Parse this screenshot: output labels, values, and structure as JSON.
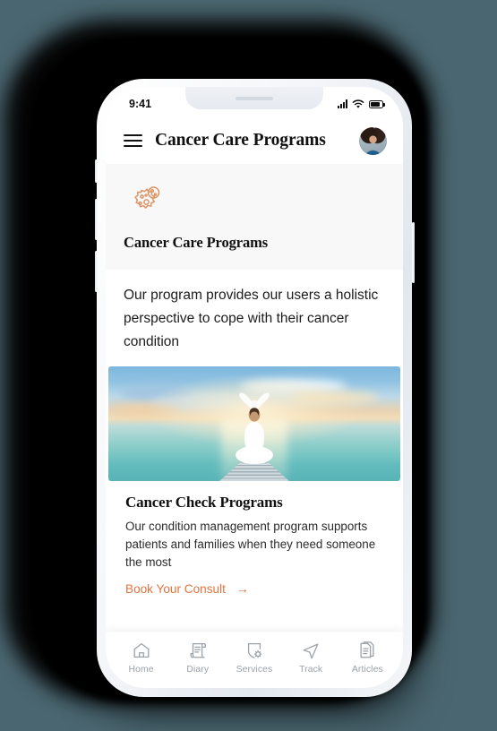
{
  "status_bar": {
    "time": "9:41",
    "signal_icon": "cellular-signal-icon",
    "wifi_icon": "wifi-icon",
    "battery_icon": "battery-icon"
  },
  "header": {
    "menu_icon": "hamburger-menu-icon",
    "title": "Cancer Care Programs",
    "avatar_icon": "user-avatar"
  },
  "intro": {
    "icon": "cancer-cell-icon",
    "title": "Cancer Care Programs"
  },
  "description": {
    "text": "Our program provides our users a holistic perspective to cope with their cancer condition"
  },
  "card": {
    "hero_image_alt": "woman-meditating-yoga-sunset-dock-ocean",
    "title": "Cancer Check Programs",
    "description": "Our condition management program supports patients and families when they need someone the most",
    "cta_label": "Book Your Consult",
    "cta_arrow": "→"
  },
  "bottom_nav": {
    "items": [
      {
        "label": "Home",
        "icon": "home-icon"
      },
      {
        "label": "Diary",
        "icon": "scroll-document-icon"
      },
      {
        "label": "Services",
        "icon": "shield-gear-icon"
      },
      {
        "label": "Track",
        "icon": "paper-plane-icon"
      },
      {
        "label": "Articles",
        "icon": "stacked-documents-icon"
      }
    ]
  },
  "colors": {
    "page_background": "#4a6670",
    "accent_orange": "#e2733f",
    "intro_background": "#f8f8f8",
    "nav_label": "#9aa1a8",
    "text_primary": "#111111"
  }
}
